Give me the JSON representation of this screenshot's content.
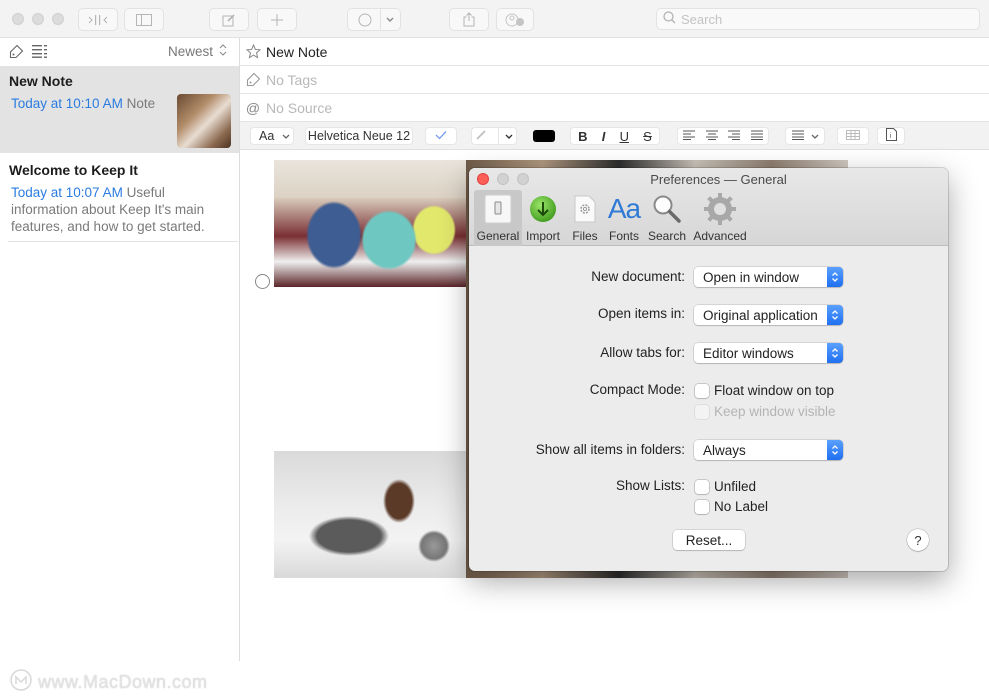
{
  "toolbar": {
    "buttons": [
      {
        "name": "toggle-split",
        "icon": "split-view-icon"
      },
      {
        "name": "toggle-sidebar",
        "icon": "sidebar-icon"
      },
      {
        "name": "compose",
        "icon": "compose-icon"
      },
      {
        "name": "add",
        "icon": "plus-icon"
      },
      {
        "name": "label",
        "icon": "circle-icon"
      },
      {
        "name": "share",
        "icon": "share-icon"
      },
      {
        "name": "people",
        "icon": "person-add-icon"
      }
    ],
    "search_placeholder": "Search"
  },
  "sidebar": {
    "sort_label": "Newest",
    "notes": [
      {
        "title": "New Note",
        "date": "Today at 10:10 AM",
        "snippet": "Note",
        "selected": true,
        "has_thumbnail": true
      },
      {
        "title": "Welcome to Keep It",
        "date": "Today at 10:07 AM",
        "snippet": "Useful information about Keep It's main features, and how to get started.",
        "selected": false,
        "has_thumbnail": false
      }
    ]
  },
  "editor": {
    "title_value": "New Note",
    "tags_placeholder": "No Tags",
    "source_placeholder": "No Source",
    "format_bar": {
      "style_label": "Aa",
      "font_label": "Helvetica Neue 12",
      "text_color": "#000000",
      "bold": "B",
      "italic": "I",
      "underline": "U",
      "strike": "S"
    }
  },
  "preferences": {
    "title": "Preferences — General",
    "tabs": [
      {
        "label": "General",
        "icon": "general-switch-icon",
        "active": true
      },
      {
        "label": "Import",
        "icon": "import-arrow-icon",
        "active": false
      },
      {
        "label": "Files",
        "icon": "files-gear-icon",
        "active": false
      },
      {
        "label": "Fonts",
        "icon": "fonts-aa-icon",
        "active": false
      },
      {
        "label": "Search",
        "icon": "magnifier-icon",
        "active": false
      },
      {
        "label": "Advanced",
        "icon": "advanced-gear-icon",
        "active": false
      }
    ],
    "fonts_glyph": "Aa",
    "new_document": {
      "label": "New document:",
      "value": "Open in window"
    },
    "open_items_in": {
      "label": "Open items in:",
      "value": "Original application"
    },
    "allow_tabs_for": {
      "label": "Allow tabs for:",
      "value": "Editor windows"
    },
    "compact_mode": {
      "label": "Compact Mode:",
      "float_on_top": {
        "label": "Float window on top",
        "checked": false
      },
      "keep_visible": {
        "label": "Keep window visible",
        "checked": false,
        "disabled": true
      }
    },
    "show_all_items": {
      "label": "Show all items in folders:",
      "value": "Always"
    },
    "show_lists": {
      "label": "Show Lists:",
      "unfiled": {
        "label": "Unfiled",
        "checked": false
      },
      "no_label": {
        "label": "No Label",
        "checked": false
      }
    },
    "reset_label": "Reset...",
    "help_label": "?"
  },
  "watermark": "www.MacDown.com",
  "colors": {
    "accent": "#2a7ce0",
    "close_red": "#fc5f57",
    "selection": "#e3e3e3"
  }
}
